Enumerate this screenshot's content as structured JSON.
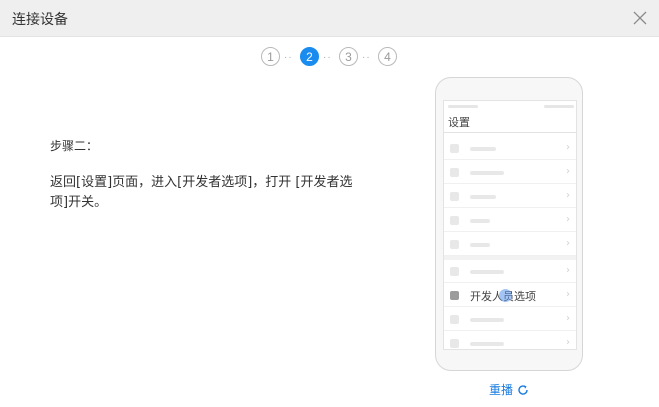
{
  "window": {
    "title": "连接设备",
    "close_icon": "close-icon"
  },
  "stepper": {
    "steps": [
      "1",
      "2",
      "3",
      "4"
    ],
    "active_index": 1,
    "separator": "··",
    "accent_color": "#1a8cf0"
  },
  "instruction": {
    "step_label": "步骤二：",
    "description": "返回[设置]页面，进入[开发者选项]，打开 [开发者选项]开关。"
  },
  "phone": {
    "screen_title": "设置",
    "highlight_label": "开发人员选项"
  },
  "replay": {
    "label": "重播",
    "icon": "refresh-icon"
  }
}
